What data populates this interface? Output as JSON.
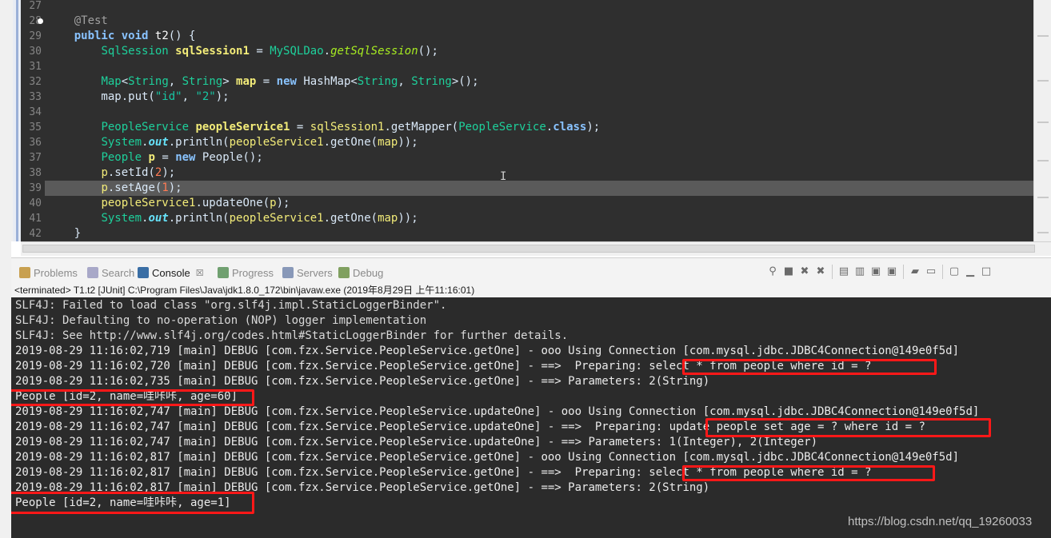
{
  "editor": {
    "lines": [
      {
        "num": "27",
        "tokens": []
      },
      {
        "num": "28",
        "fold": true,
        "tokens": [
          {
            "t": "    "
          },
          {
            "t": "@Test",
            "c": "an"
          }
        ]
      },
      {
        "num": "29",
        "tokens": [
          {
            "t": "    "
          },
          {
            "t": "public",
            "c": "kw"
          },
          {
            "t": " "
          },
          {
            "t": "void",
            "c": "kw"
          },
          {
            "t": " "
          },
          {
            "t": "t2",
            "c": "pl"
          },
          {
            "t": "() {"
          }
        ]
      },
      {
        "num": "30",
        "tokens": [
          {
            "t": "        "
          },
          {
            "t": "SqlSession",
            "c": "ty"
          },
          {
            "t": " "
          },
          {
            "t": "sqlSession1",
            "c": "vard"
          },
          {
            "t": " = "
          },
          {
            "t": "MySQLDao",
            "c": "ty"
          },
          {
            "t": "."
          },
          {
            "t": "getSqlSession",
            "c": "sti"
          },
          {
            "t": "();"
          }
        ]
      },
      {
        "num": "31",
        "tokens": []
      },
      {
        "num": "32",
        "tokens": [
          {
            "t": "        "
          },
          {
            "t": "Map",
            "c": "ty"
          },
          {
            "t": "<"
          },
          {
            "t": "String",
            "c": "ty"
          },
          {
            "t": ", "
          },
          {
            "t": "String",
            "c": "ty"
          },
          {
            "t": "> "
          },
          {
            "t": "map",
            "c": "vard"
          },
          {
            "t": " = "
          },
          {
            "t": "new",
            "c": "kw"
          },
          {
            "t": " HashMap<"
          },
          {
            "t": "String",
            "c": "ty"
          },
          {
            "t": ", "
          },
          {
            "t": "String",
            "c": "ty"
          },
          {
            "t": ">();"
          }
        ]
      },
      {
        "num": "33",
        "tokens": [
          {
            "t": "        map.put("
          },
          {
            "t": "\"id\"",
            "c": "str"
          },
          {
            "t": ", "
          },
          {
            "t": "\"2\"",
            "c": "str"
          },
          {
            "t": ");"
          }
        ]
      },
      {
        "num": "34",
        "tokens": []
      },
      {
        "num": "35",
        "tokens": [
          {
            "t": "        "
          },
          {
            "t": "PeopleService",
            "c": "ty"
          },
          {
            "t": " "
          },
          {
            "t": "peopleService1",
            "c": "vard"
          },
          {
            "t": " = "
          },
          {
            "t": "sqlSession1",
            "c": "var"
          },
          {
            "t": ".getMapper("
          },
          {
            "t": "PeopleService",
            "c": "ty"
          },
          {
            "t": "."
          },
          {
            "t": "class",
            "c": "kw"
          },
          {
            "t": ");"
          }
        ]
      },
      {
        "num": "36",
        "tokens": [
          {
            "t": "        "
          },
          {
            "t": "System",
            "c": "ty"
          },
          {
            "t": "."
          },
          {
            "t": "out",
            "c": "fld"
          },
          {
            "t": ".println("
          },
          {
            "t": "peopleService1",
            "c": "var"
          },
          {
            "t": ".getOne("
          },
          {
            "t": "map",
            "c": "var"
          },
          {
            "t": "));"
          }
        ]
      },
      {
        "num": "37",
        "tokens": [
          {
            "t": "        "
          },
          {
            "t": "People",
            "c": "ty"
          },
          {
            "t": " "
          },
          {
            "t": "p",
            "c": "vard"
          },
          {
            "t": " = "
          },
          {
            "t": "new",
            "c": "kw"
          },
          {
            "t": " People();"
          }
        ]
      },
      {
        "num": "38",
        "tokens": [
          {
            "t": "        "
          },
          {
            "t": "p",
            "c": "var"
          },
          {
            "t": ".setId("
          },
          {
            "t": "2",
            "c": "num"
          },
          {
            "t": ");"
          }
        ]
      },
      {
        "num": "39",
        "highlight": true,
        "tokens": [
          {
            "t": "        "
          },
          {
            "t": "p",
            "c": "var"
          },
          {
            "t": ".setAge("
          },
          {
            "t": "1",
            "c": "num"
          },
          {
            "t": ");"
          }
        ]
      },
      {
        "num": "40",
        "tokens": [
          {
            "t": "        "
          },
          {
            "t": "peopleService1",
            "c": "var"
          },
          {
            "t": ".updateOne("
          },
          {
            "t": "p",
            "c": "var"
          },
          {
            "t": ");"
          }
        ]
      },
      {
        "num": "41",
        "tokens": [
          {
            "t": "        "
          },
          {
            "t": "System",
            "c": "ty"
          },
          {
            "t": "."
          },
          {
            "t": "out",
            "c": "fld"
          },
          {
            "t": ".println("
          },
          {
            "t": "peopleService1",
            "c": "var"
          },
          {
            "t": ".getOne("
          },
          {
            "t": "map",
            "c": "var"
          },
          {
            "t": "));"
          }
        ]
      },
      {
        "num": "42",
        "tokens": [
          {
            "t": "    }"
          }
        ]
      }
    ]
  },
  "views": {
    "tabs": [
      {
        "label": "Problems",
        "icon": "problems-icon",
        "active": false
      },
      {
        "label": "Search",
        "icon": "search-icon",
        "active": false
      },
      {
        "label": "Console",
        "icon": "console-icon",
        "active": true,
        "close": "☒"
      },
      {
        "label": "Progress",
        "icon": "progress-icon",
        "active": false
      },
      {
        "label": "Servers",
        "icon": "servers-icon",
        "active": false
      },
      {
        "label": "Debug",
        "icon": "debug-icon",
        "active": false
      }
    ],
    "toolbar_icons": [
      "pin-icon",
      "stop-icon",
      "remove-launch-icon",
      "remove-all-icon",
      "sep",
      "scroll-lock-icon",
      "word-wrap-icon",
      "show-stdout-icon",
      "show-stderr-icon",
      "sep",
      "pin-console-icon",
      "display-console-icon",
      "sep",
      "open-console-icon",
      "minimize-icon",
      "maximize-icon"
    ]
  },
  "console": {
    "status": "<terminated> T1.t2 [JUnit] C:\\Program Files\\Java\\jdk1.8.0_172\\bin\\javaw.exe (2019年8月29日 上午11:16:01)",
    "lines": [
      "SLF4J: Failed to load class \"org.slf4j.impl.StaticLoggerBinder\".",
      "SLF4J: Defaulting to no-operation (NOP) logger implementation",
      "SLF4J: See http://www.slf4j.org/codes.html#StaticLoggerBinder for further details.",
      "2019-08-29 11:16:02,719 [main] DEBUG [com.fzx.Service.PeopleService.getOne] - ooo Using Connection [com.mysql.jdbc.JDBC4Connection@149e0f5d]",
      "2019-08-29 11:16:02,720 [main] DEBUG [com.fzx.Service.PeopleService.getOne] - ==>  Preparing: select * from people where id = ?",
      "2019-08-29 11:16:02,735 [main] DEBUG [com.fzx.Service.PeopleService.getOne] - ==> Parameters: 2(String)",
      "People [id=2, name=哇咔咔, age=60]",
      "2019-08-29 11:16:02,747 [main] DEBUG [com.fzx.Service.PeopleService.updateOne] - ooo Using Connection [com.mysql.jdbc.JDBC4Connection@149e0f5d]",
      "2019-08-29 11:16:02,747 [main] DEBUG [com.fzx.Service.PeopleService.updateOne] - ==>  Preparing: update people set age = ? where id = ?",
      "2019-08-29 11:16:02,747 [main] DEBUG [com.fzx.Service.PeopleService.updateOne] - ==> Parameters: 1(Integer), 2(Integer)",
      "2019-08-29 11:16:02,817 [main] DEBUG [com.fzx.Service.PeopleService.getOne] - ooo Using Connection [com.mysql.jdbc.JDBC4Connection@149e0f5d]",
      "2019-08-29 11:16:02,817 [main] DEBUG [com.fzx.Service.PeopleService.getOne] - ==>  Preparing: select * from people where id = ?",
      "2019-08-29 11:16:02,817 [main] DEBUG [com.fzx.Service.PeopleService.getOne] - ==> Parameters: 2(String)",
      "People [id=2, name=哇咔咔, age=1]"
    ],
    "watermark": "https://blog.csdn.net/qq_19260033",
    "highlight_color": "#ff1818"
  }
}
